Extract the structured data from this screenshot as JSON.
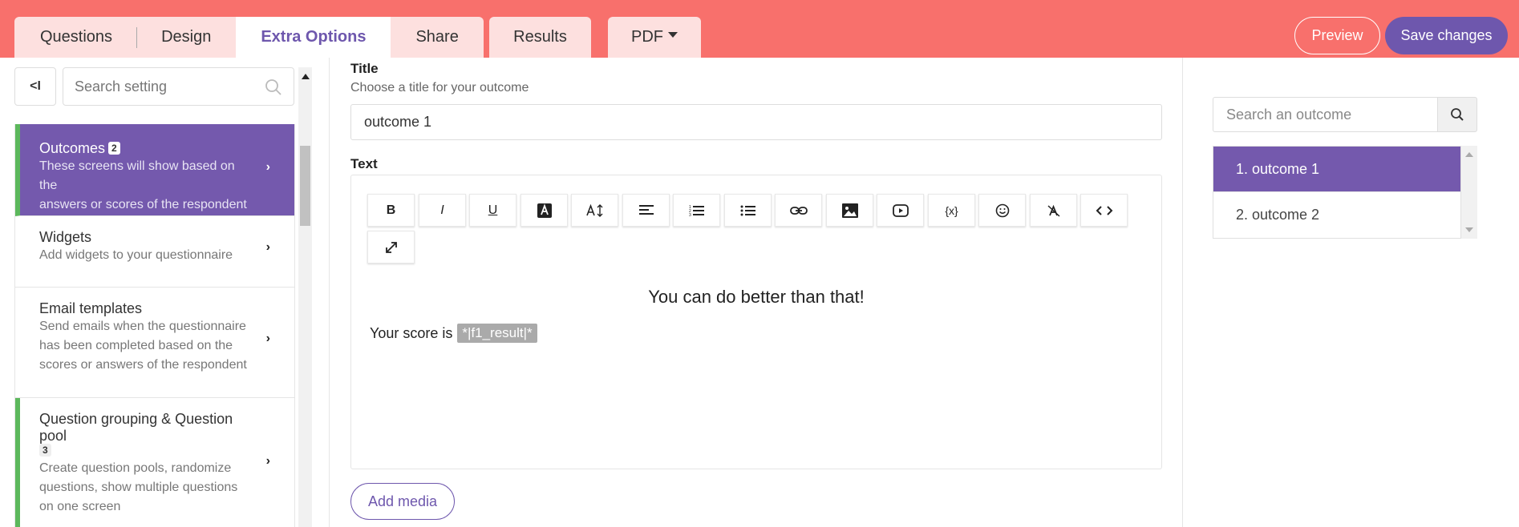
{
  "tabs": {
    "questions": "Questions",
    "design": "Design",
    "extra_options": "Extra Options",
    "share": "Share",
    "results": "Results",
    "pdf": "PDF"
  },
  "actions": {
    "preview": "Preview",
    "save": "Save changes"
  },
  "left": {
    "collapse_label": "<I",
    "search_placeholder": "Search setting",
    "items": [
      {
        "title": "Outcomes",
        "badge": "2",
        "desc1": "These screens will show based on the",
        "desc2": "answers or scores of the respondent"
      },
      {
        "title": "Widgets",
        "desc1": "Add widgets to your questionnaire"
      },
      {
        "title": "Email templates",
        "desc1": "Send emails when the questionnaire",
        "desc2": "has been completed based on the",
        "desc3": "scores or answers of the respondent"
      },
      {
        "title": "Question grouping & Question pool",
        "badge": "3",
        "desc1": "Create question pools, randomize",
        "desc2": "questions, show multiple questions",
        "desc3": "on one screen"
      }
    ]
  },
  "editor": {
    "title_label": "Title",
    "title_help": "Choose a title for your outcome",
    "title_value": "outcome 1",
    "text_label": "Text",
    "heading_text": "You can do better than that!",
    "score_text": "Your score is",
    "merge_tag": "*|f1_result|*",
    "add_media": "Add media",
    "toolbar": {
      "bold": "B",
      "italic": "I",
      "underline": "U",
      "vars": "{x}"
    }
  },
  "outcomes": {
    "search_placeholder": "Search an outcome",
    "items": [
      "1. outcome 1",
      "2. outcome 2"
    ]
  },
  "colors": {
    "topbar": "#f8706c",
    "accent": "#6e57ad",
    "active_item": "#7459ad",
    "marker": "#5cb85c"
  }
}
